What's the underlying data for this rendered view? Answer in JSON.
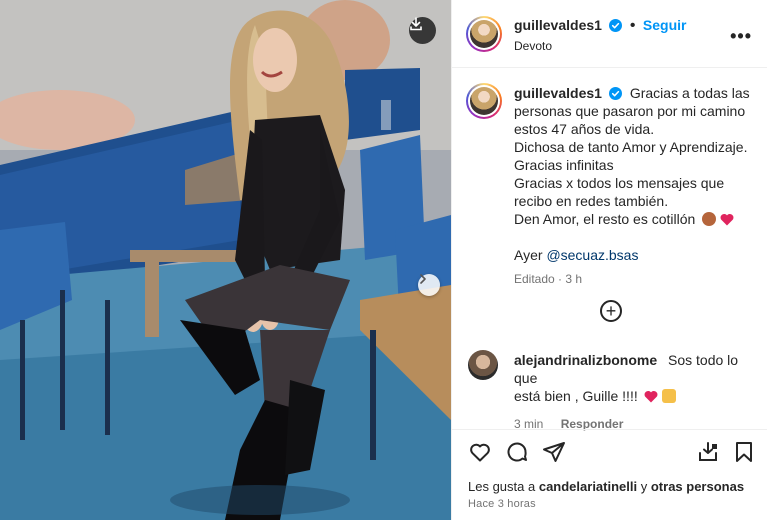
{
  "post": {
    "author": "guillevaldes1",
    "follow_label": "Seguir",
    "location": "Devoto",
    "more_label": "•••"
  },
  "caption": {
    "username": "guillevaldes1",
    "lines": [
      "Gracias a todas las",
      "personas que pasaron por mi camino",
      "estos 47 años de vida.",
      "Dichosa de tanto Amor y Aprendizaje.",
      "Gracias infinitas",
      "Gracias x todos los mensajes que",
      "recibo en redes también.",
      "Den Amor, el resto es cotillón"
    ],
    "credit_prefix": "Ayer",
    "credit_mention": "@secuaz.bsas",
    "edited": "Editado · 3 h"
  },
  "comment": {
    "username": "alejandrinalizbonome",
    "text_1": "Sos todo lo que",
    "text_2": "está bien , Guille !!!!",
    "time": "3 min",
    "reply_label": "Responder"
  },
  "likes": {
    "prefix": "Les gusta a",
    "user": "candelariatinelli",
    "middle": "y",
    "others": "otras personas"
  },
  "posted_time": "Hace 3 horas",
  "colors": {
    "accent_blue": "#0095f6",
    "mention_blue": "#00376b",
    "verified": "#0095f6",
    "heart_red": "#e0245e"
  }
}
